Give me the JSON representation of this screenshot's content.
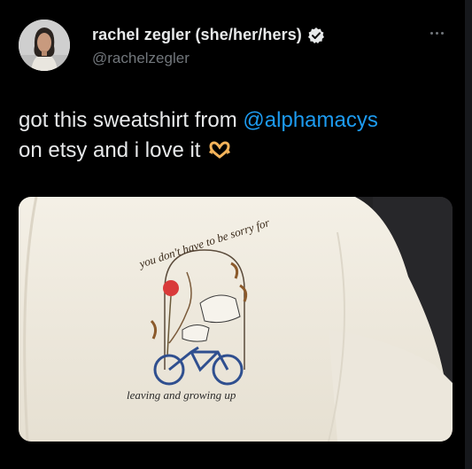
{
  "tweet": {
    "display_name": "rachel zegler (she/her/hers)",
    "handle": "@rachelzegler",
    "text_before": "got this sweatshirt from ",
    "mention": "@alphamacys",
    "text_after": "on etsy and i love it",
    "emoji": "heart-hands-emoji",
    "verified": true
  },
  "media": {
    "embroidery_top": "you don't have to be sorry for",
    "embroidery_bottom": "leaving and growing up"
  },
  "colors": {
    "background": "#000000",
    "text": "#e7e9ea",
    "secondary": "#71767b",
    "link": "#1d9bf0"
  }
}
